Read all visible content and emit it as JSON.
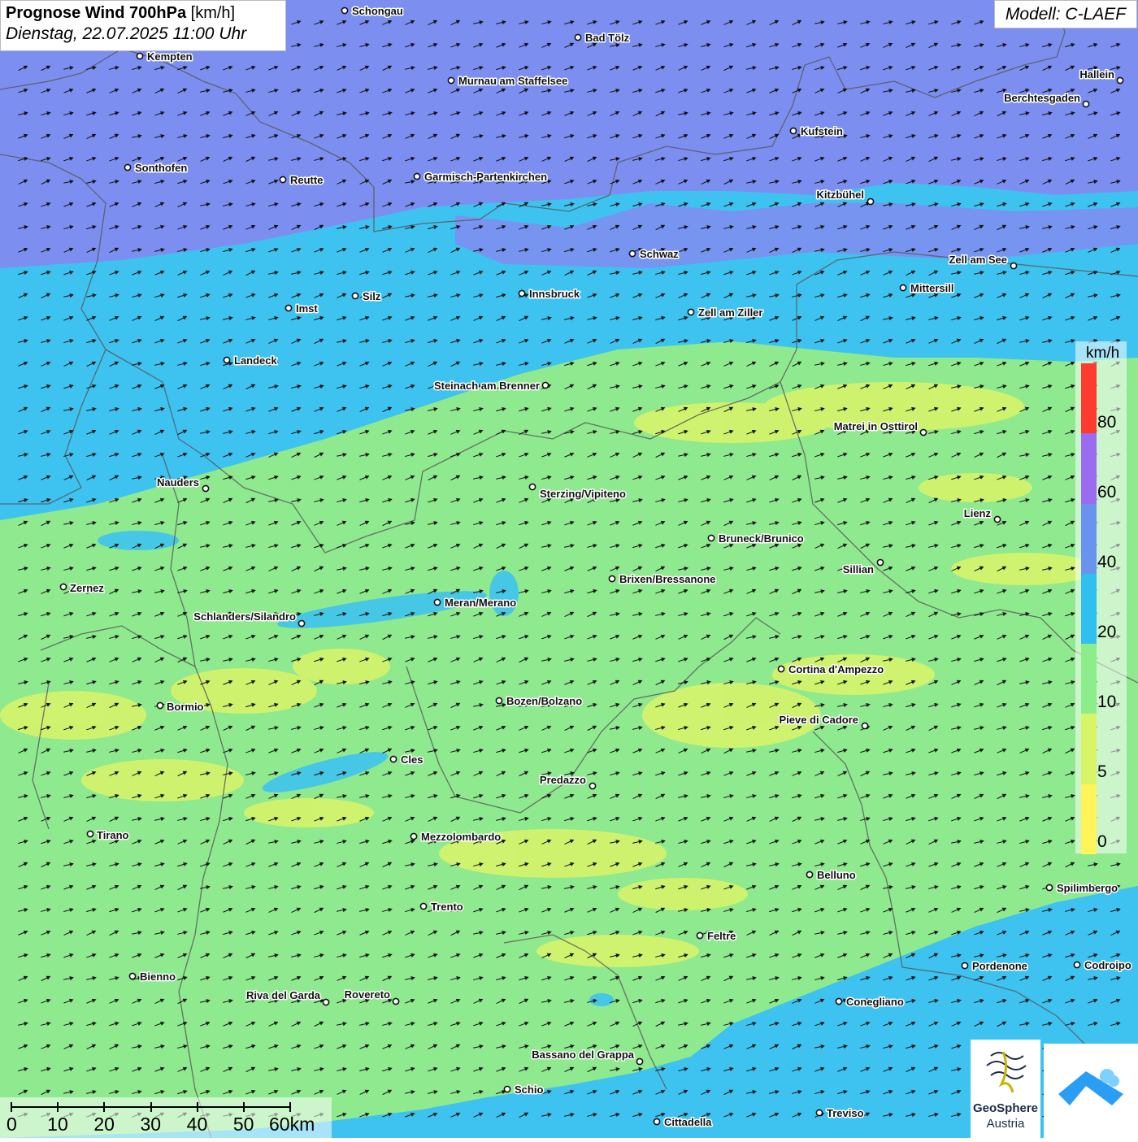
{
  "title": {
    "bold": "Prognose Wind 700hPa",
    "unit": "[km/h]",
    "datetime": "Dienstag, 22.07.2025 11:00 Uhr"
  },
  "model": "Modell: C-LAEF",
  "legend": {
    "unit": "km/h",
    "ticks": [
      "80",
      "60",
      "40",
      "20",
      "10",
      "5",
      "0"
    ],
    "colors": [
      "#ff3b30",
      "#9b6cf0",
      "#6a93ef",
      "#2fc0ef",
      "#8ded8a",
      "#d8f567",
      "#fff55a"
    ]
  },
  "scale": {
    "ticks": [
      "0",
      "10",
      "20",
      "30",
      "40",
      "50",
      "60km"
    ]
  },
  "logo": {
    "name": "GeoSphere",
    "sub": "Austria"
  },
  "cities": [
    {
      "name": "Schongau"
    },
    {
      "name": "Bad Tölz"
    },
    {
      "name": "Kempten"
    },
    {
      "name": "Murnau am Staffelsee"
    },
    {
      "name": "Hallein"
    },
    {
      "name": "Berchtesgaden"
    },
    {
      "name": "Kufstein"
    },
    {
      "name": "Sonthofen"
    },
    {
      "name": "Reutte"
    },
    {
      "name": "Garmisch-Partenkirchen"
    },
    {
      "name": "Kitzbühel"
    },
    {
      "name": "Schwaz"
    },
    {
      "name": "Zell am See"
    },
    {
      "name": "Mittersill"
    },
    {
      "name": "Innsbruck"
    },
    {
      "name": "Silz"
    },
    {
      "name": "Imst"
    },
    {
      "name": "Zell am Ziller"
    },
    {
      "name": "Landeck"
    },
    {
      "name": "Steinach am Brenner"
    },
    {
      "name": "Matrei in Osttirol"
    },
    {
      "name": "Nauders"
    },
    {
      "name": "Sterzing/Vipiteno"
    },
    {
      "name": "Lienz"
    },
    {
      "name": "Bruneck/Brunico"
    },
    {
      "name": "Sillian"
    },
    {
      "name": "Brixen/Bressanone"
    },
    {
      "name": "Zernez"
    },
    {
      "name": "Meran/Merano"
    },
    {
      "name": "Schlanders/Silandro"
    },
    {
      "name": "Cortina d'Ampezzo"
    },
    {
      "name": "Bozen/Bolzano"
    },
    {
      "name": "Bormio"
    },
    {
      "name": "Pieve di Cadore"
    },
    {
      "name": "Cles"
    },
    {
      "name": "Predazzo"
    },
    {
      "name": "Tirano"
    },
    {
      "name": "Mezzolombardo"
    },
    {
      "name": "Belluno"
    },
    {
      "name": "Spilimbergo"
    },
    {
      "name": "Trento"
    },
    {
      "name": "Feltre"
    },
    {
      "name": "Bienno"
    },
    {
      "name": "Pordenone"
    },
    {
      "name": "Codroipo"
    },
    {
      "name": "Riva del Garda"
    },
    {
      "name": "Rovereto"
    },
    {
      "name": "Conegliano"
    },
    {
      "name": "Bassano del Grappa"
    },
    {
      "name": "Schio"
    },
    {
      "name": "Treviso"
    },
    {
      "name": "Cittadella"
    }
  ]
}
